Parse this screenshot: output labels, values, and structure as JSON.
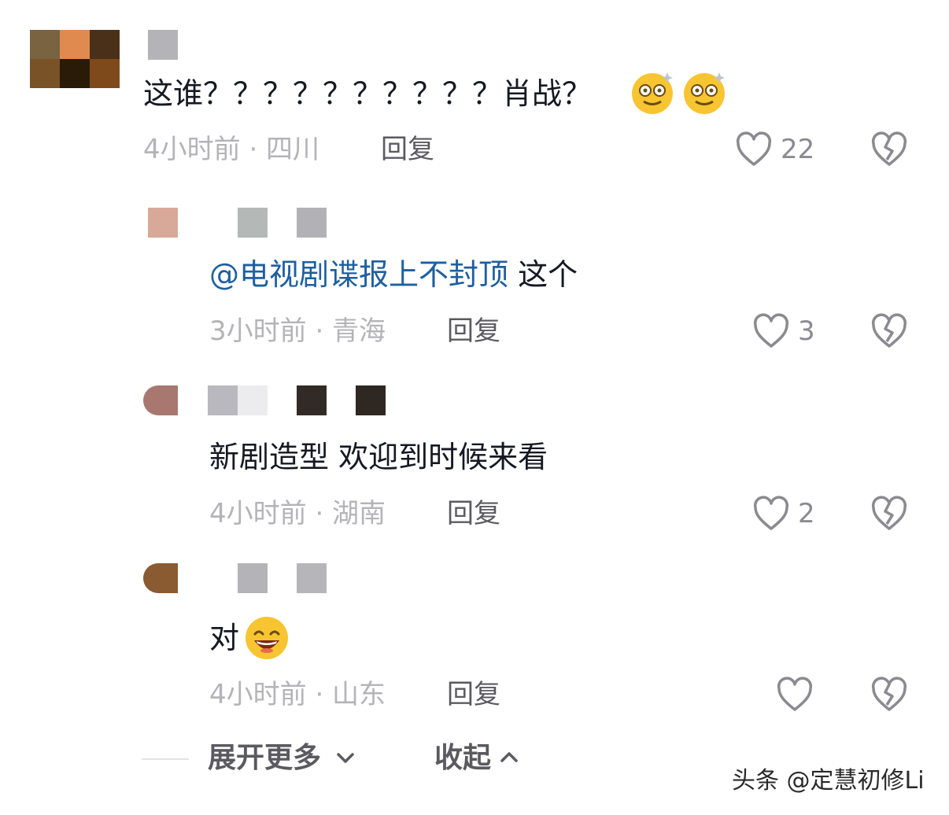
{
  "comments": [
    {
      "text": "这谁？？？？？？？？？？肖战？",
      "time_location": "4小时前 · 四川",
      "reply_label": "回复",
      "likes": "22",
      "emojis": [
        "dizzy-face-emoji",
        "dizzy-face-emoji"
      ]
    },
    {
      "mention": "@电视剧谍报上不封顶",
      "text": " 这个",
      "time_location": "3小时前 · 青海",
      "reply_label": "回复",
      "likes": "3"
    },
    {
      "text": "新剧造型 欢迎到时候来看",
      "time_location": "4小时前 · 湖南",
      "reply_label": "回复",
      "likes": "2"
    },
    {
      "text": "对",
      "time_location": "4小时前 · 山东",
      "reply_label": "回复",
      "likes": "",
      "emojis": [
        "grinning-face-emoji"
      ]
    }
  ],
  "footer": {
    "expand_label": "展开更多",
    "collapse_label": "收起"
  },
  "watermark": "头条 @定慧初修Li",
  "icons": {
    "like": "heart-outline-icon",
    "dislike": "broken-heart-icon",
    "expand": "chevron-down-icon",
    "collapse": "chevron-up-icon"
  },
  "colors": {
    "text": "#161823",
    "mention": "#1e5fa0",
    "meta": "#b4b4b8",
    "reply": "#5a5a60"
  }
}
